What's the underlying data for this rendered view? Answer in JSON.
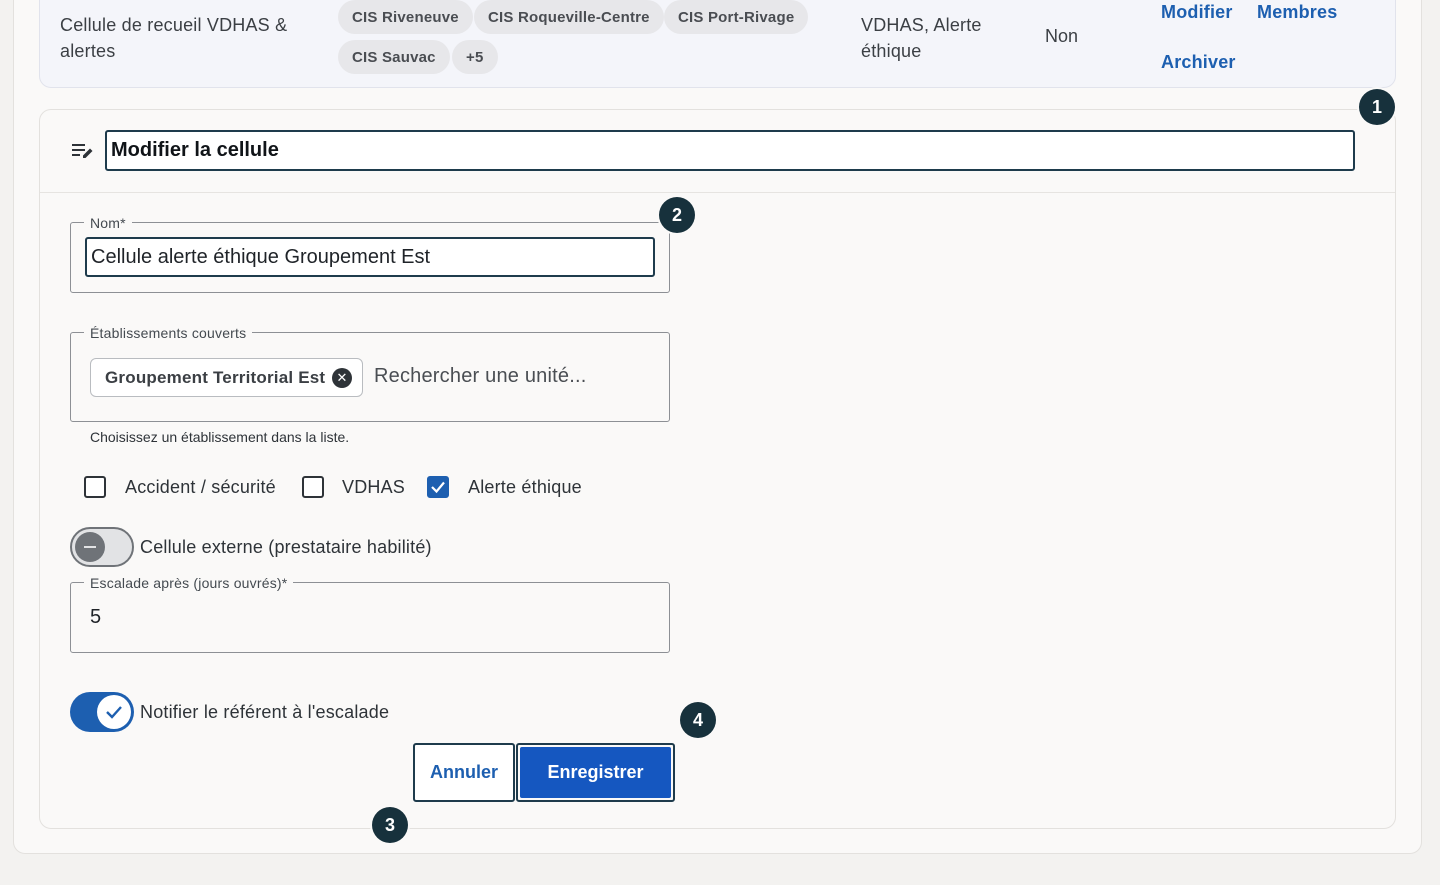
{
  "existing_cell": {
    "name": "Cellule de recueil VDHAS & alertes",
    "units": [
      "CIS Riveneuve",
      "CIS Roqueville-Centre",
      "CIS Port-Rivage",
      "CIS Sauvac",
      "+5"
    ],
    "types": "VDHAS, Alerte éthique",
    "external": "Non",
    "actions": {
      "edit": "Modifier",
      "members": "Membres",
      "archive": "Archiver"
    }
  },
  "edit_form": {
    "title": "Modifier la cellule",
    "name_field": {
      "label": "Nom*",
      "value": "Cellule alerte éthique Groupement Est"
    },
    "units_field": {
      "label": "Établissements couverts",
      "selected": [
        "Groupement Territorial Est"
      ],
      "placeholder": "Rechercher une unité...",
      "helper": "Choisissez un établissement dans la liste."
    },
    "types": [
      {
        "label": "Accident / sécurité",
        "checked": false
      },
      {
        "label": "VDHAS",
        "checked": false
      },
      {
        "label": "Alerte éthique",
        "checked": true
      }
    ],
    "external_toggle": {
      "label": "Cellule externe (prestataire habilité)",
      "on": false
    },
    "escalation_field": {
      "label": "Escalade après (jours ouvrés)*",
      "value": "5"
    },
    "notify_toggle": {
      "label": "Notifier le référent à l'escalade",
      "on": true
    },
    "buttons": {
      "cancel": "Annuler",
      "save": "Enregistrer"
    }
  },
  "badges": [
    "1",
    "2",
    "3",
    "4"
  ],
  "colors": {
    "accent": "#1d5fb0",
    "focus_outline": "#1e3b4c",
    "badge": "#17313c"
  }
}
